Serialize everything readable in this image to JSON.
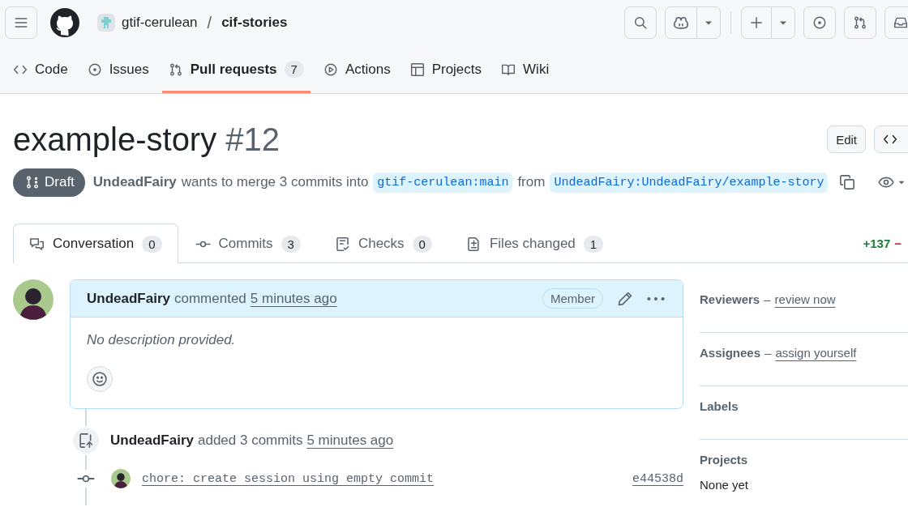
{
  "header": {
    "owner": "gtif-cerulean",
    "separator": "/",
    "repo": "cif-stories"
  },
  "repo_nav": [
    {
      "label": "Code",
      "selected": false
    },
    {
      "label": "Issues",
      "selected": false
    },
    {
      "label": "Pull requests",
      "count": "7",
      "selected": true
    },
    {
      "label": "Actions",
      "selected": false
    },
    {
      "label": "Projects",
      "selected": false
    },
    {
      "label": "Wiki",
      "selected": false
    }
  ],
  "pull_request": {
    "title": "example-story",
    "number": "#12",
    "edit_button": "Edit",
    "status": "Draft",
    "author": "UndeadFairy",
    "summary": "wants to merge 3 commits into",
    "base": "gtif-cerulean:main",
    "from_text": "from",
    "head": "UndeadFairy:UndeadFairy/example-story"
  },
  "pr_tabs": [
    {
      "label": "Conversation",
      "count": "0",
      "selected": true
    },
    {
      "label": "Commits",
      "count": "3",
      "selected": false
    },
    {
      "label": "Checks",
      "count": "0",
      "selected": false
    },
    {
      "label": "Files changed",
      "count": "1",
      "selected": false
    }
  ],
  "diffstat": {
    "additions": "+137",
    "deletions": "−"
  },
  "comment": {
    "author": "UndeadFairy",
    "action": "commented",
    "time": "5 minutes ago",
    "role": "Member",
    "body": "No description provided."
  },
  "commit_event": {
    "author": "UndeadFairy",
    "action": "added 3 commits",
    "time": "5 minutes ago"
  },
  "commits": [
    {
      "message": "chore: create session using empty commit",
      "sha": "e44538d"
    }
  ],
  "sidebar": [
    {
      "heading": "Reviewers",
      "separator": "–",
      "link": "review now"
    },
    {
      "heading": "Assignees",
      "separator": "–",
      "link": "assign yourself"
    },
    {
      "heading": "Labels"
    },
    {
      "heading": "Projects",
      "value": "None yet"
    }
  ]
}
